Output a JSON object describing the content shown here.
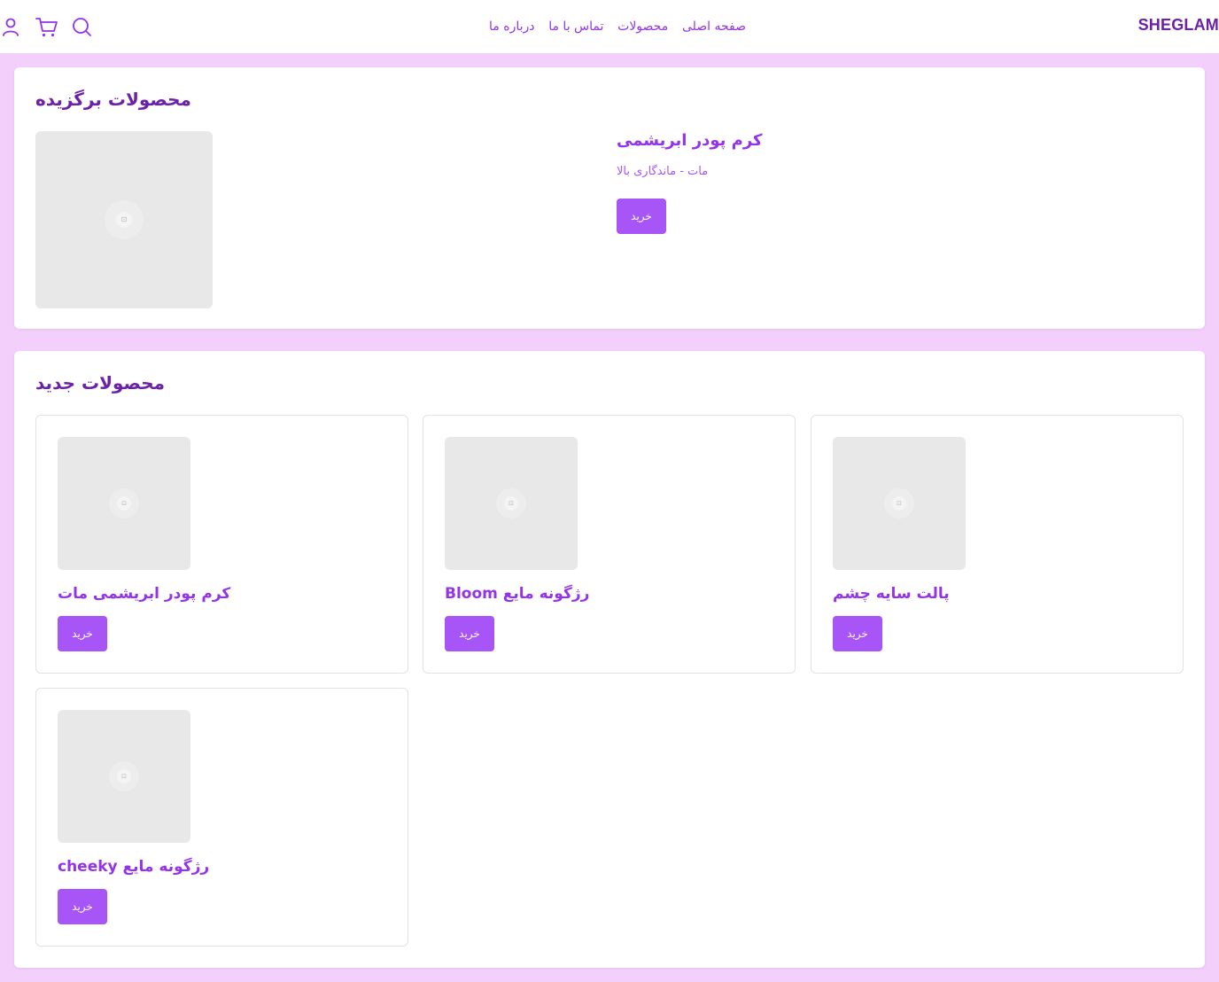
{
  "header": {
    "logo": "SHEGLAM",
    "nav": [
      "درباره ما",
      "تماس با ما",
      "محصولات",
      "صفحه اصلی"
    ],
    "icons": [
      "search-icon",
      "cart-icon",
      "user-icon"
    ]
  },
  "featured": {
    "title": "محصولات برگزیده",
    "product": {
      "name": "کرم پودر ابریشمی",
      "description": "مات - ماندگاری بالا",
      "buy_label": "خرید"
    }
  },
  "new_products": {
    "title": "محصولات جدید",
    "items": [
      {
        "name": "پالت سایه چشم",
        "buy_label": "خرید"
      },
      {
        "name": "رژگونه مایع Bloom",
        "buy_label": "خرید"
      },
      {
        "name": "کرم پودر ابریشمی مات",
        "buy_label": "خرید"
      },
      {
        "name": "رژگونه مایع cheeky",
        "buy_label": "خرید"
      }
    ]
  },
  "colors": {
    "page_bg": "#f3d0fb",
    "brand": "#6b21a8",
    "accent": "#9333ea",
    "button": "#a855f7"
  }
}
